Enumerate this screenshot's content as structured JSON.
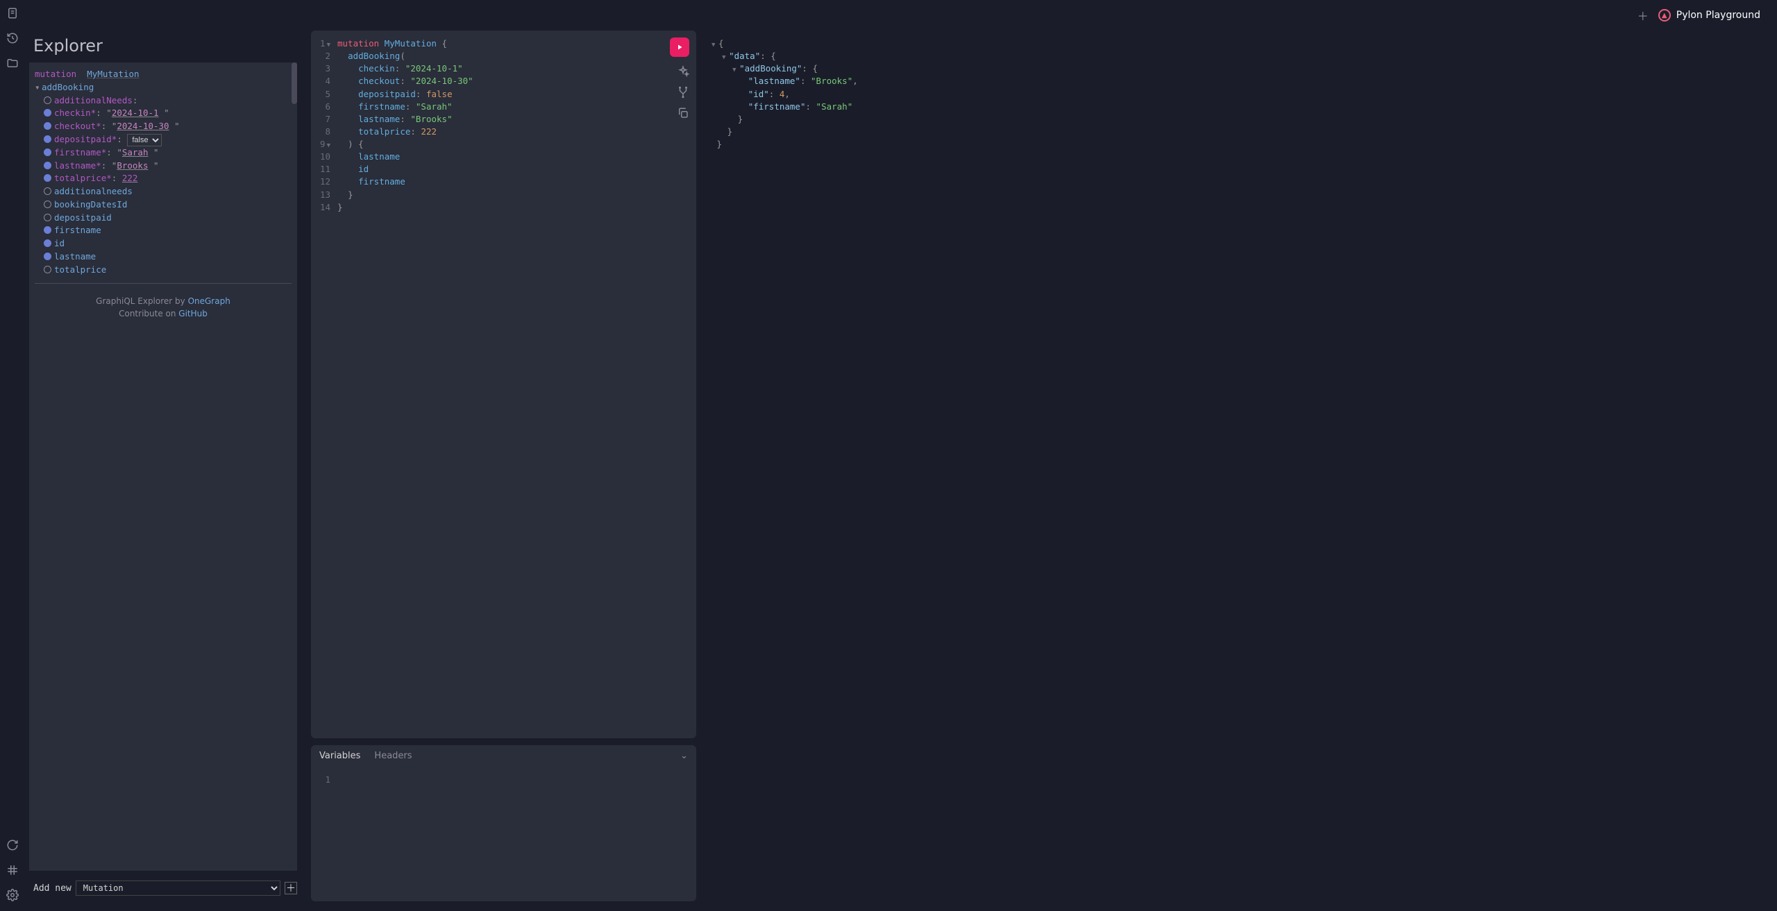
{
  "brand": {
    "name": "Pylon Playground"
  },
  "iconbar": {
    "names": [
      "docs",
      "history",
      "folder",
      "refresh",
      "keyboard",
      "settings"
    ]
  },
  "explorer": {
    "title": "Explorer",
    "mutation_kw": "mutation",
    "op_name": "MyMutation",
    "root_field": "addBooking",
    "args": [
      {
        "name": "additionalNeeds",
        "checked": false,
        "value": ""
      },
      {
        "name": "checkin*",
        "checked": true,
        "value": "2024-10-1"
      },
      {
        "name": "checkout*",
        "checked": true,
        "value": "2024-10-30"
      },
      {
        "name": "depositpaid*",
        "checked": true,
        "select": "false"
      },
      {
        "name": "firstname*",
        "checked": true,
        "value": "Sarah"
      },
      {
        "name": "lastname*",
        "checked": true,
        "value": "Brooks"
      },
      {
        "name": "totalprice*",
        "checked": true,
        "num": "222"
      }
    ],
    "selections": [
      {
        "name": "additionalneeds",
        "checked": false
      },
      {
        "name": "bookingDatesId",
        "checked": false
      },
      {
        "name": "depositpaid",
        "checked": false
      },
      {
        "name": "firstname",
        "checked": true
      },
      {
        "name": "id",
        "checked": true
      },
      {
        "name": "lastname",
        "checked": true
      },
      {
        "name": "totalprice",
        "checked": false
      }
    ],
    "credit_prefix": "GraphiQL Explorer by ",
    "credit_link": "OneGraph",
    "contrib_prefix": "Contribute on ",
    "contrib_link": "GitHub",
    "addnew_label": "Add new",
    "addnew_select": "Mutation"
  },
  "editor": {
    "source": {
      "kw_mutation": "mutation",
      "op_name": "MyMutation",
      "fn": "addBooking",
      "args": [
        {
          "k": "checkin",
          "v": "\"2024-10-1\"",
          "t": "str"
        },
        {
          "k": "checkout",
          "v": "\"2024-10-30\"",
          "t": "str"
        },
        {
          "k": "depositpaid",
          "v": "false",
          "t": "bool"
        },
        {
          "k": "firstname",
          "v": "\"Sarah\"",
          "t": "str"
        },
        {
          "k": "lastname",
          "v": "\"Brooks\"",
          "t": "str"
        },
        {
          "k": "totalprice",
          "v": "222",
          "t": "num"
        }
      ],
      "sel": [
        "lastname",
        "id",
        "firstname"
      ]
    },
    "line_count": 14
  },
  "vars": {
    "tabs": [
      "Variables",
      "Headers"
    ],
    "active_tab": 0,
    "line": "1"
  },
  "result": {
    "data_key": "\"data\"",
    "addBooking_key": "\"addBooking\"",
    "fields": [
      {
        "k": "\"lastname\"",
        "v": "\"Brooks\"",
        "t": "str",
        "comma": ","
      },
      {
        "k": "\"id\"",
        "v": "4",
        "t": "num",
        "comma": ","
      },
      {
        "k": "\"firstname\"",
        "v": "\"Sarah\"",
        "t": "str",
        "comma": ""
      }
    ]
  }
}
